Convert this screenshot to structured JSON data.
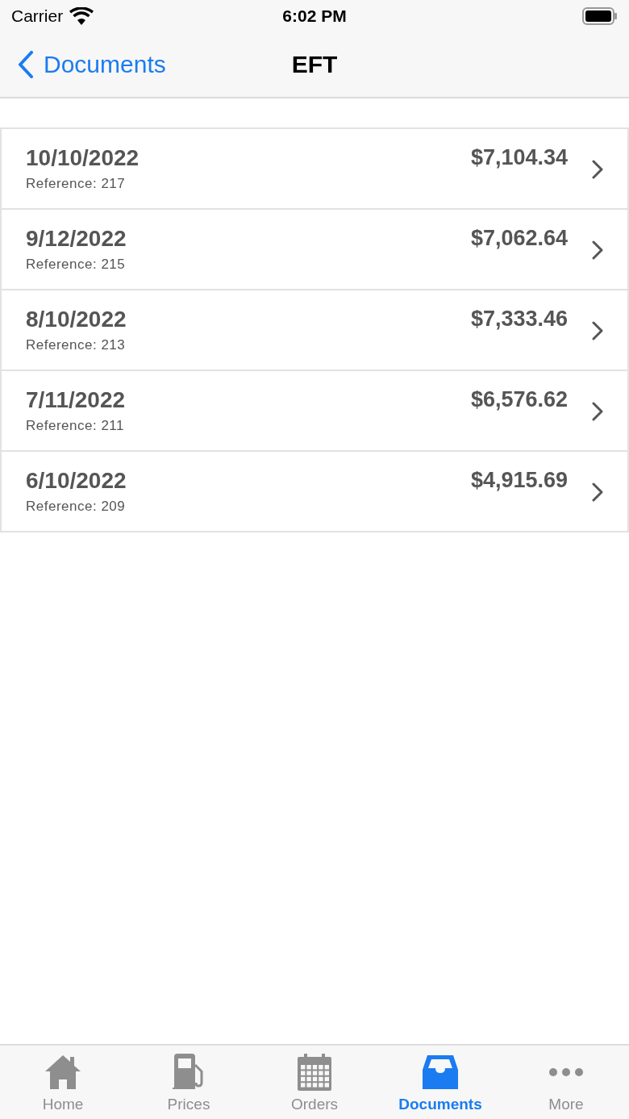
{
  "status_bar": {
    "carrier": "Carrier",
    "time": "6:02 PM"
  },
  "nav": {
    "back_label": "Documents",
    "title": "EFT"
  },
  "rows": [
    {
      "date": "10/10/2022",
      "reference": "Reference: 217",
      "amount": "$7,104.34"
    },
    {
      "date": "9/12/2022",
      "reference": "Reference: 215",
      "amount": "$7,062.64"
    },
    {
      "date": "8/10/2022",
      "reference": "Reference: 213",
      "amount": "$7,333.46"
    },
    {
      "date": "7/11/2022",
      "reference": "Reference: 211",
      "amount": "$6,576.62"
    },
    {
      "date": "6/10/2022",
      "reference": "Reference: 209",
      "amount": "$4,915.69"
    }
  ],
  "tabs": [
    {
      "label": "Home",
      "selected": false
    },
    {
      "label": "Prices",
      "selected": false
    },
    {
      "label": "Orders",
      "selected": false
    },
    {
      "label": "Documents",
      "selected": true
    },
    {
      "label": "More",
      "selected": false
    }
  ]
}
